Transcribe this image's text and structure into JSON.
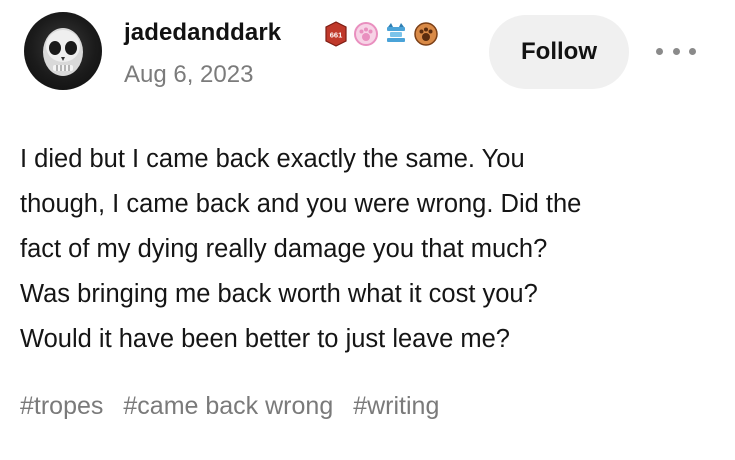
{
  "post": {
    "author": {
      "username": "jadedanddark",
      "avatar_icon": "skull-face-avatar",
      "badges": [
        {
          "icon": "red-rank-badge-icon",
          "text": "661",
          "color": "#c0392b"
        },
        {
          "icon": "pink-paw-badge-icon",
          "color": "#e98fbf"
        },
        {
          "icon": "blue-cat-badge-icon",
          "color": "#4aa3d8"
        },
        {
          "icon": "orange-paw-badge-icon",
          "color": "#a45a2a"
        }
      ]
    },
    "date": "Aug 6, 2023",
    "follow_label": "Follow",
    "more_icon": "more-options-icon",
    "body_lines": [
      "I died but I came back exactly the same. You",
      "though, I came back and you were wrong. Did the",
      "fact of my dying really damage you that much?",
      "Was bringing me back worth what it cost you?",
      "Would it have been better to just leave me?"
    ],
    "tags": [
      "#tropes",
      "#came back wrong",
      "#writing"
    ]
  }
}
